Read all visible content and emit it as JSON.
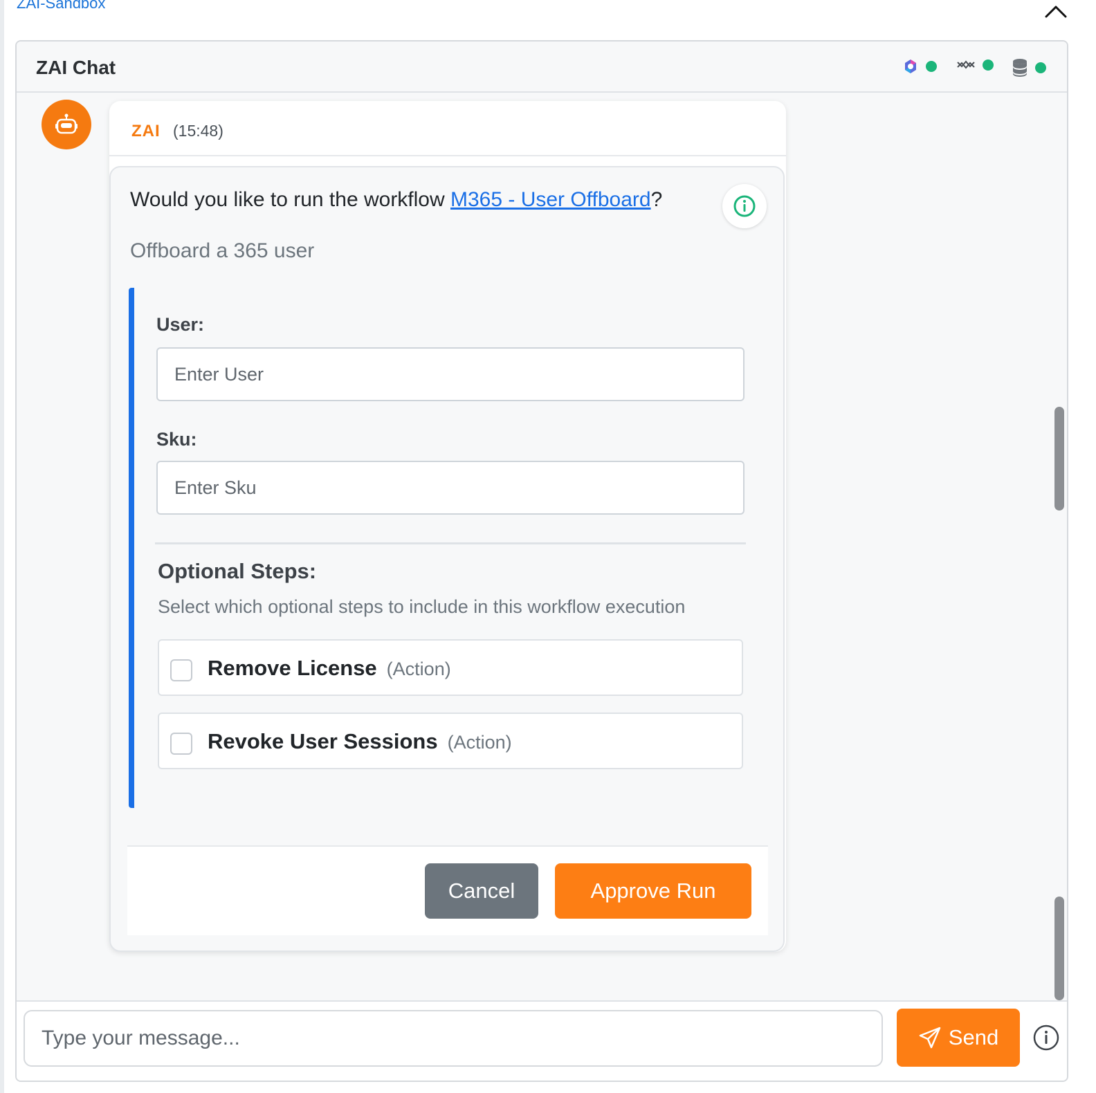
{
  "app": {
    "workspace_link": "ZAI-Sandbox"
  },
  "chat": {
    "title": "ZAI Chat",
    "status_indicators": [
      {
        "icon": "copilot-icon",
        "status_color": "#1bb57a"
      },
      {
        "icon": "network-icon",
        "status_color": "#1bb57a"
      },
      {
        "icon": "database-icon",
        "status_color": "#1bb57a"
      }
    ]
  },
  "message": {
    "sender": "ZAI",
    "time": "(15:48)",
    "question_prefix": "Would you like to run the workflow ",
    "workflow_name": "M365 - User Offboard",
    "question_suffix": "?",
    "description": "Offboard a 365 user",
    "fields": [
      {
        "label": "User:",
        "placeholder": "Enter User",
        "value": ""
      },
      {
        "label": "Sku:",
        "placeholder": "Enter Sku",
        "value": ""
      }
    ],
    "optional_steps": {
      "title": "Optional Steps:",
      "description": "Select which optional steps to include in this workflow execution",
      "items": [
        {
          "name": "Remove License",
          "type": "(Action)",
          "checked": false
        },
        {
          "name": "Revoke User Sessions",
          "type": "(Action)",
          "checked": false
        }
      ]
    },
    "cancel_label": "Cancel",
    "approve_label": "Approve Run"
  },
  "composer": {
    "placeholder": "Type your message...",
    "value": "",
    "send_label": "Send"
  },
  "colors": {
    "accent_orange": "#fd7e14",
    "link_blue": "#1a6fe6",
    "status_green": "#1bb57a",
    "cancel_gray": "#6c757d"
  }
}
